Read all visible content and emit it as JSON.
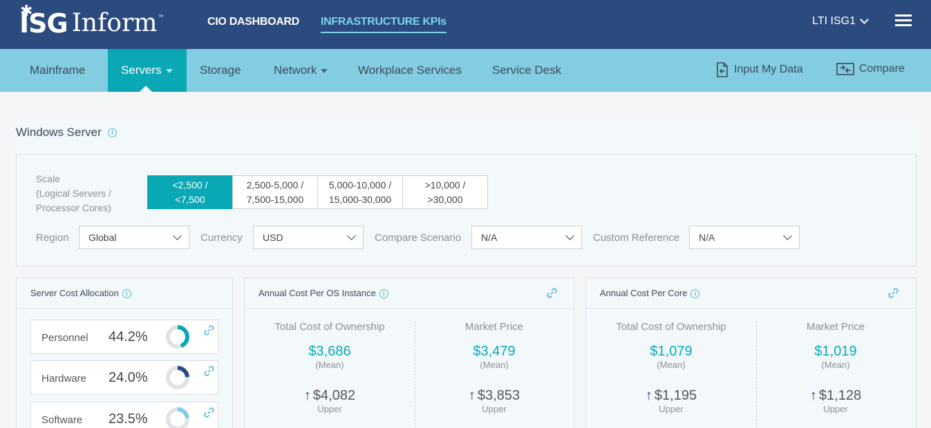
{
  "brand": {
    "isg": "ISG",
    "inform": "Inform",
    "tm": "™"
  },
  "topnav": {
    "items": [
      "CIO DASHBOARD",
      "INFRASTRUCTURE KPIs"
    ],
    "active": 1
  },
  "account": {
    "label": "LTI ISG1"
  },
  "subnav": {
    "items": [
      {
        "label": "Mainframe",
        "caret": false
      },
      {
        "label": "Servers",
        "caret": true
      },
      {
        "label": "Storage",
        "caret": false
      },
      {
        "label": "Network",
        "caret": true
      },
      {
        "label": "Workplace Services",
        "caret": false
      },
      {
        "label": "Service Desk",
        "caret": false
      }
    ],
    "active": 1,
    "actions": {
      "input": "Input My Data",
      "compare": "Compare"
    }
  },
  "panel": {
    "title": "Windows Server"
  },
  "filters": {
    "scale_label_line1": "Scale",
    "scale_label_line2": "(Logical Servers /",
    "scale_label_line3": "Processor Cores)",
    "scale_options": [
      {
        "line1": "<2,500 /",
        "line2": "<7,500"
      },
      {
        "line1": "2,500-5,000 /",
        "line2": "7,500-15,000"
      },
      {
        "line1": "5,000-10,000 /",
        "line2": "15,000-30,000"
      },
      {
        "line1": ">10,000 /",
        "line2": ">30,000"
      }
    ],
    "scale_active": 0,
    "region": {
      "label": "Region",
      "value": "Global"
    },
    "currency": {
      "label": "Currency",
      "value": "USD"
    },
    "compare": {
      "label": "Compare Scenario",
      "value": "N/A"
    },
    "custom": {
      "label": "Custom Reference",
      "value": "N/A"
    }
  },
  "allocation": {
    "title": "Server Cost Allocation",
    "rows": [
      {
        "label": "Personnel",
        "pct": "44.2%",
        "value": 0.442,
        "color": "#0aa8b5"
      },
      {
        "label": "Hardware",
        "pct": "24.0%",
        "value": 0.24,
        "color": "#2b4a7e"
      },
      {
        "label": "Software",
        "pct": "23.5%",
        "value": 0.235,
        "color": "#82cde2"
      }
    ]
  },
  "os_instance": {
    "title": "Annual Cost Per OS Instance",
    "tco": {
      "heading": "Total Cost of Ownership",
      "mean": "$3,686",
      "mean_label": "(Mean)",
      "upper": "$4,082",
      "upper_label": "Upper"
    },
    "market": {
      "heading": "Market Price",
      "mean": "$3,479",
      "mean_label": "(Mean)",
      "upper": "$3,853",
      "upper_label": "Upper"
    }
  },
  "per_core": {
    "title": "Annual Cost Per Core",
    "tco": {
      "heading": "Total Cost of Ownership",
      "mean": "$1,079",
      "mean_label": "(Mean)",
      "upper": "$1,195",
      "upper_label": "Upper"
    },
    "market": {
      "heading": "Market Price",
      "mean": "$1,019",
      "mean_label": "(Mean)",
      "upper": "$1,128",
      "upper_label": "Upper"
    }
  },
  "colors": {
    "header": "#2b4a7e",
    "subnav": "#82cde2",
    "accent": "#0aa8b5"
  }
}
